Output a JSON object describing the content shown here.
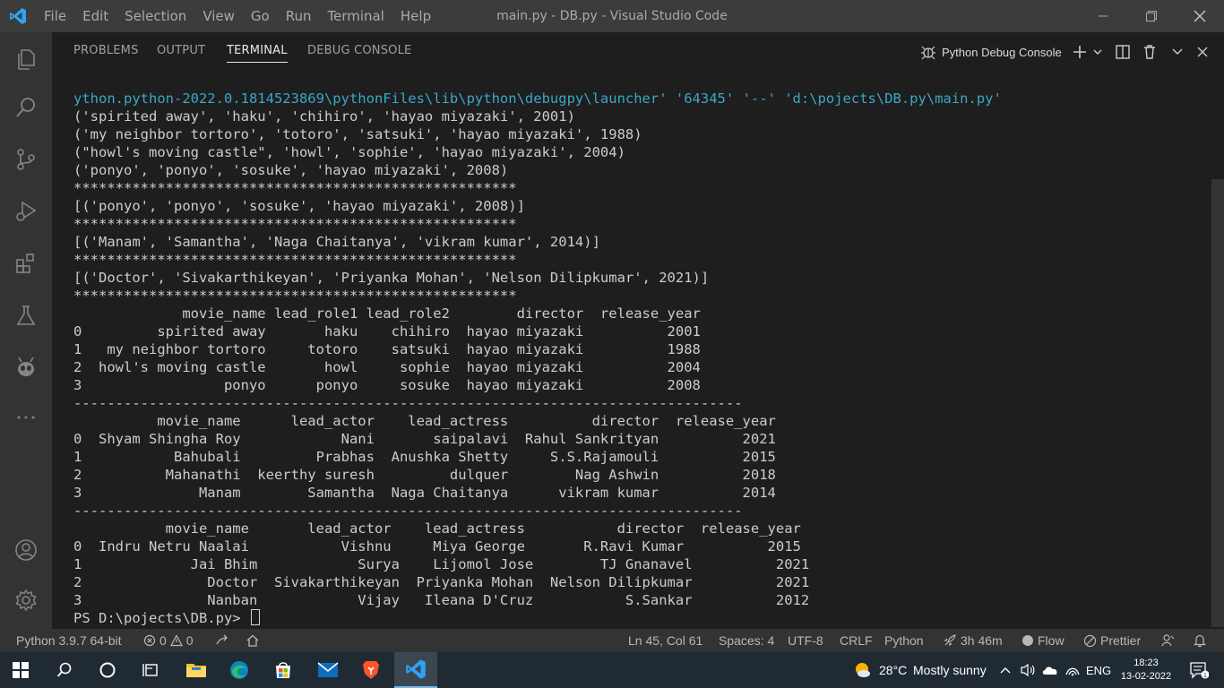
{
  "titlebar": {
    "menus": [
      "File",
      "Edit",
      "Selection",
      "View",
      "Go",
      "Run",
      "Terminal",
      "Help"
    ],
    "title": "main.py - DB.py - Visual Studio Code"
  },
  "panel": {
    "tabs": [
      "PROBLEMS",
      "OUTPUT",
      "TERMINAL",
      "DEBUG CONSOLE"
    ],
    "active_tab": "TERMINAL",
    "terminal_select": "Python Debug Console"
  },
  "terminal": {
    "lines": [
      "ython.python-2022.0.1814523869\\pythonFiles\\lib\\python\\debugpy\\launcher' '64345' '--' 'd:\\pojects\\DB.py\\main.py'",
      "('spirited away', 'haku', 'chihiro', 'hayao miyazaki', 2001)",
      "('my neighbor tortoro', 'totoro', 'satsuki', 'hayao miyazaki', 1988)",
      "(\"howl's moving castle\", 'howl', 'sophie', 'hayao miyazaki', 2004)",
      "('ponyo', 'ponyo', 'sosuke', 'hayao miyazaki', 2008)",
      "*****************************************************",
      "[('ponyo', 'ponyo', 'sosuke', 'hayao miyazaki', 2008)]",
      "*****************************************************",
      "[('Manam', 'Samantha', 'Naga Chaitanya', 'vikram kumar', 2014)]",
      "*****************************************************",
      "[('Doctor', 'Sivakarthikeyan', 'Priyanka Mohan', 'Nelson Dilipkumar', 2021)]",
      "*****************************************************",
      "             movie_name lead_role1 lead_role2        director  release_year",
      "0         spirited away       haku    chihiro  hayao miyazaki          2001",
      "1   my neighbor tortoro     totoro    satsuki  hayao miyazaki          1988",
      "2  howl's moving castle       howl     sophie  hayao miyazaki          2004",
      "3                 ponyo      ponyo     sosuke  hayao miyazaki          2008",
      "--------------------------------------------------------------------------------",
      "          movie_name      lead_actor    lead_actress          director  release_year",
      "0  Shyam Shingha Roy            Nani       saipalavi  Rahul Sankrityan          2021",
      "1           Bahubali         Prabhas  Anushka Shetty     S.S.Rajamouli          2015",
      "2          Mahanathi  keerthy suresh         dulquer        Nag Ashwin          2018",
      "3              Manam        Samantha  Naga Chaitanya      vikram kumar          2014",
      "--------------------------------------------------------------------------------",
      "           movie_name       lead_actor    lead_actress           director  release_year",
      "0  Indru Netru Naalai           Vishnu     Miya George       R.Ravi Kumar          2015",
      "1             Jai Bhim            Surya    Lijomol Jose        TJ Gnanavel          2021",
      "2               Doctor  Sivakarthikeyan  Priyanka Mohan  Nelson Dilipkumar          2021",
      "3               Nanban            Vijay   Ileana D'Cruz           S.Sankar          2012"
    ],
    "prompt": "PS D:\\pojects\\DB.py> "
  },
  "statusbar": {
    "python": "Python 3.9.7 64-bit",
    "errors": "0",
    "warnings": "0",
    "position": "Ln 45, Col 61",
    "spaces": "Spaces: 4",
    "encoding": "UTF-8",
    "eol": "CRLF",
    "language": "Python",
    "time_tracked": "3h 46m",
    "flow": "Flow",
    "prettier": "Prettier"
  },
  "taskbar": {
    "weather_temp": "28°C",
    "weather_desc": "Mostly sunny",
    "lang": "ENG",
    "time": "18:23",
    "date": "13-02-2022",
    "notification_count": "1"
  },
  "colors": {
    "accent_blue": "#0e7acc",
    "terminal_command": "#3aa7c9",
    "brave_orange": "#fb542b"
  }
}
